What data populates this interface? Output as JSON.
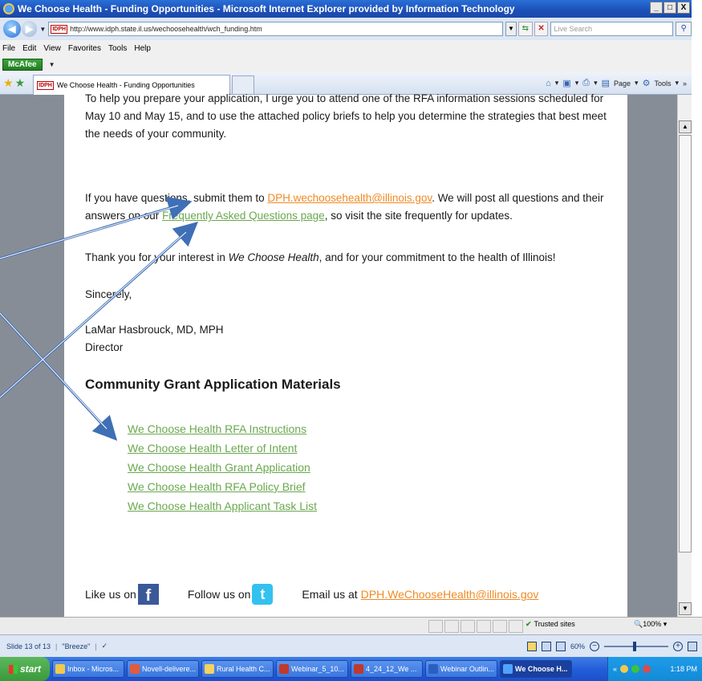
{
  "window": {
    "title": "We Choose Health - Funding Opportunities - Microsoft Internet Explorer provided by Information Technology",
    "min": "_",
    "max": "□",
    "close": "X"
  },
  "address": {
    "favicon": "IDPH",
    "url": "http://www.idph.state.il.us/wechoosehealth/wch_funding.htm",
    "search_placeholder": "Live Search"
  },
  "menu": [
    "File",
    "Edit",
    "View",
    "Favorites",
    "Tools",
    "Help"
  ],
  "toolbar": {
    "mcafee": "McAfee"
  },
  "tabs": {
    "active_label": "We Choose Health - Funding Opportunities",
    "page_label": "Page",
    "tools_label": "Tools"
  },
  "content": {
    "para1": "To help you prepare your application, I urge you to attend one of the RFA information sessions scheduled for May 10 and May 15, and to use the attached policy briefs to help you determine the strategies that best meet the needs of your community.",
    "para2_pre": "If you have questions, submit them to ",
    "para2_email": "DPH.wechoosehealth@illinois.gov",
    "para2_mid": ". We will post all questions and their answers on our ",
    "para2_faq": "Frequently Asked Questions page",
    "para2_post": ", so visit the site frequently for updates.",
    "para3_pre": "Thank you for your interest in ",
    "para3_em": "We Choose Health",
    "para3_post": ", and for your commitment to the health of Illinois!",
    "sincerely": "Sincerely,",
    "signer_name": "LaMar Hasbrouck, MD, MPH",
    "signer_title": "Director",
    "section_heading": "Community Grant Application Materials",
    "links": [
      "We Choose Health RFA Instructions",
      "We Choose Health Letter of Intent",
      "We Choose Health Grant Application",
      "We Choose Health RFA Policy Brief",
      "We Choose Health Applicant Task List"
    ],
    "like_us": "Like us on",
    "follow_us": "Follow us on",
    "email_us": "Email us at",
    "footer_email": "DPH.WeChooseHealth@illinois.gov"
  },
  "status": {
    "zone": "Trusted sites",
    "zoom": "100%"
  },
  "ppt": {
    "slide": "Slide 13 of 13",
    "theme": "\"Breeze\"",
    "zoom": "60%"
  },
  "taskbar": {
    "start": "start",
    "items": [
      "Inbox - Micros...",
      "Novell-delivere...",
      "Rural Health C...",
      "Webinar_5_10...",
      "4_24_12_We ...",
      "Webinar Outlin...",
      "We Choose H..."
    ],
    "clock": "1:18 PM"
  },
  "colors": {
    "link_green": "#6aa84f",
    "email_orange": "#f08a24",
    "side_gray": "#878d96",
    "arrow_blue": "#3f6fb5"
  }
}
